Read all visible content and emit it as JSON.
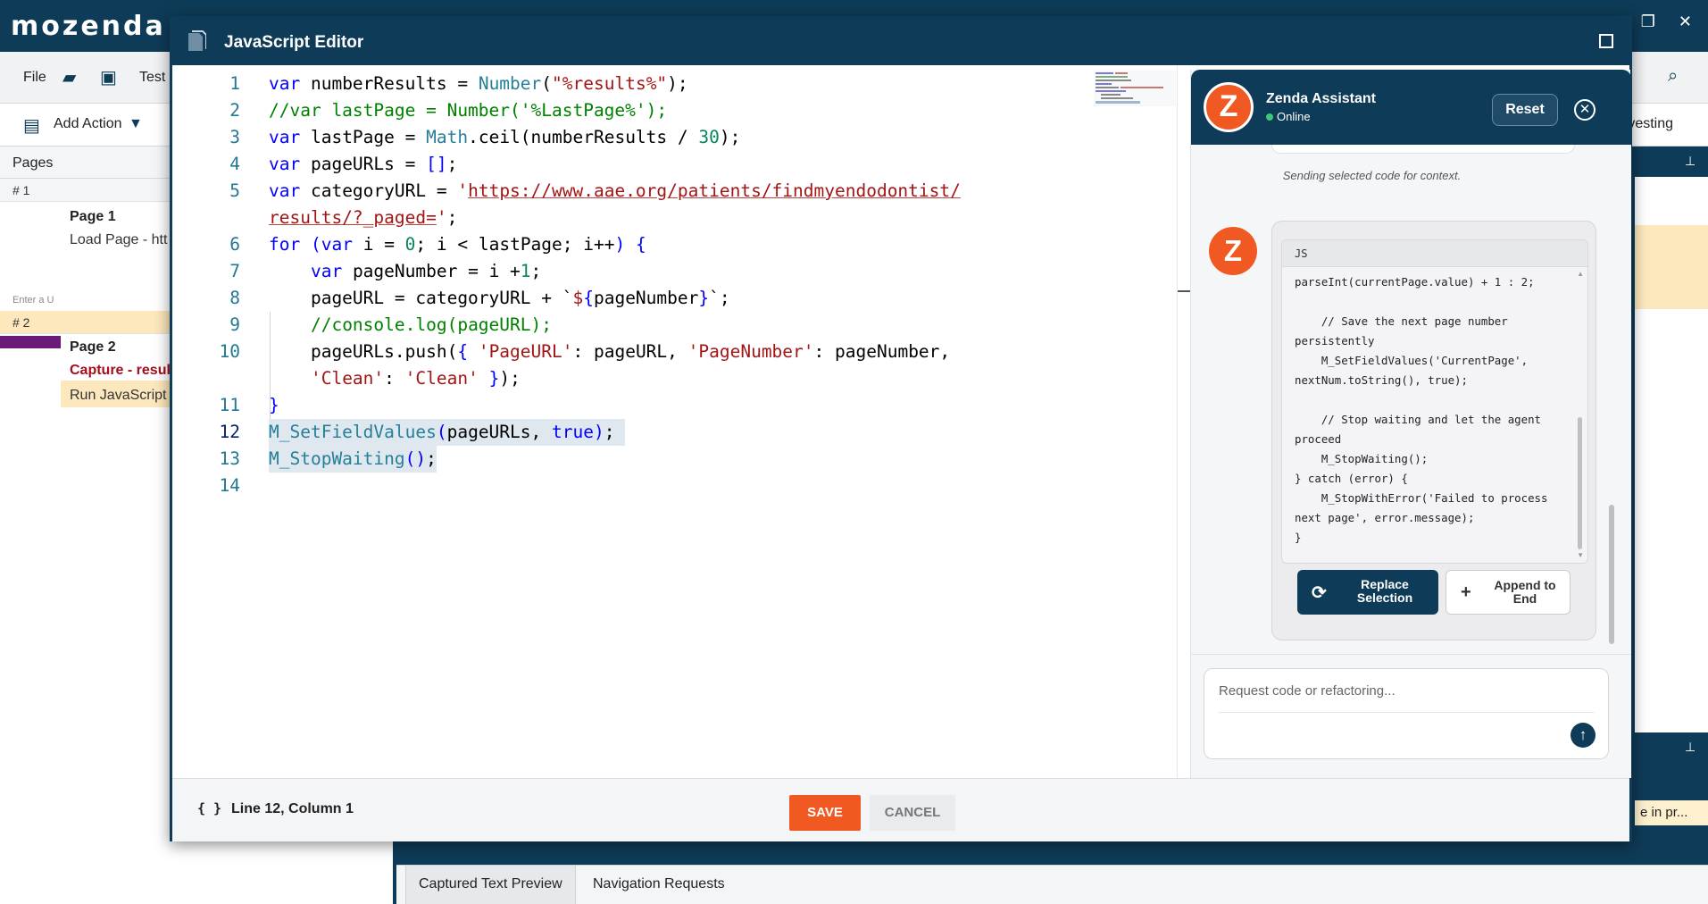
{
  "background_app": {
    "logo": "mozenda",
    "menu": {
      "file": "File",
      "test": "Test"
    },
    "toolbar": {
      "add_action": "Add Action",
      "harvesting": "rvesting"
    },
    "pages_header": "Pages",
    "pages": [
      {
        "num": "# 1",
        "title": "Page 1",
        "desc": "Load Page - htt"
      },
      {
        "num": "# 2",
        "title": "Page 2",
        "capture": "Capture - resul",
        "run_js": "Run JavaScript"
      }
    ],
    "enter_hint": "Enter a U",
    "right_snippet": "e in pr...",
    "bottom_tabs": {
      "captured": "Captured Text Preview",
      "navigation": "Navigation Requests"
    }
  },
  "dialog": {
    "title": "JavaScript Editor",
    "footer": {
      "braces": "{ }",
      "cursor_position": "Line 12, Column 1",
      "save": "SAVE",
      "cancel": "CANCEL"
    }
  },
  "assistant": {
    "name": "Zenda Assistant",
    "status": "Online",
    "avatar_letter": "Z",
    "reset": "Reset",
    "close_glyph": "✕",
    "sending_note": "Sending selected code for context.",
    "code_lang": "JS",
    "code_snippet": "parseInt(currentPage.value) + 1 : 2;\n\n    // Save the next page number persistently\n    M_SetFieldValues('CurrentPage', nextNum.toString(), true);\n\n    // Stop waiting and let the agent proceed\n    M_StopWaiting();\n} catch (error) {\n    M_StopWithError('Failed to process next page', error.message);\n}",
    "replace_label": "Replace\nSelection",
    "append_label": "Append to\nEnd",
    "input_placeholder": "Request code or refactoring..."
  },
  "colors": {
    "brand_dark": "#0e3b57",
    "accent_orange": "#f05a22",
    "status_online": "#3fc77a"
  }
}
